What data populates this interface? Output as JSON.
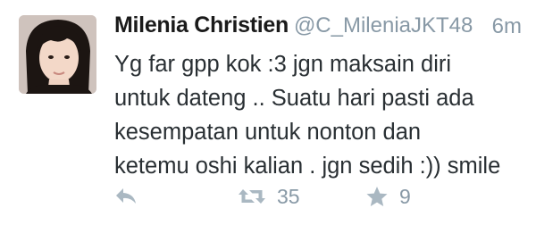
{
  "tweet": {
    "author_name": "Milenia Christien",
    "handle": "@C_MileniaJKT48",
    "time": "6m",
    "text": "Yg far gpp kok :3 jgn maksain diri\nuntuk dateng .. Suatu hari pasti ada\nkesempatan untuk nonton dan\nketemu oshi kalian . jgn sedih :)) smile",
    "retweet_count": "35",
    "favorite_count": "9"
  },
  "icons": {
    "reply": "reply-icon",
    "retweet": "retweet-icon",
    "favorite": "star-icon"
  },
  "colors": {
    "name": "#1a1a1a",
    "secondary": "#8899a6",
    "icon": "#aab8c2",
    "text": "#292f33"
  }
}
